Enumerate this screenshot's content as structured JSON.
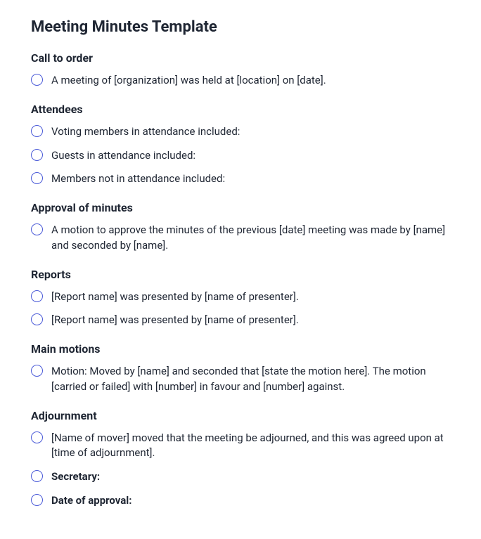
{
  "title": "Meeting Minutes Template",
  "sections": [
    {
      "heading": "Call to order",
      "items": [
        {
          "text": "A meeting of [organization] was held at [location] on [date].",
          "bold": false
        }
      ]
    },
    {
      "heading": "Attendees",
      "items": [
        {
          "text": "Voting members in attendance included:",
          "bold": false
        },
        {
          "text": "Guests in attendance included:",
          "bold": false
        },
        {
          "text": "Members not in attendance included:",
          "bold": false
        }
      ]
    },
    {
      "heading": "Approval of minutes",
      "items": [
        {
          "text": "A motion to approve the minutes of the previous [date] meeting was made by [name] and seconded by [name].",
          "bold": false
        }
      ]
    },
    {
      "heading": "Reports",
      "items": [
        {
          "text": "[Report name] was presented by [name of presenter].",
          "bold": false
        },
        {
          "text": "[Report name] was presented by [name of presenter].",
          "bold": false
        }
      ]
    },
    {
      "heading": "Main motions",
      "items": [
        {
          "text": "Motion: Moved by [name] and seconded that [state the motion here]. The motion [carried or failed] with [number] in favour and [number] against.",
          "bold": false
        }
      ]
    },
    {
      "heading": "Adjournment",
      "items": [
        {
          "text": "[Name of mover] moved that the meeting be adjourned, and this was agreed upon at [time of adjournment].",
          "bold": false
        },
        {
          "text": "Secretary:",
          "bold": true
        },
        {
          "text": "Date of approval:",
          "bold": true
        }
      ]
    }
  ]
}
